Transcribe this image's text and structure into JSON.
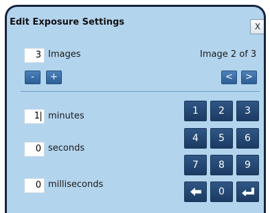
{
  "dialog": {
    "title": "Edit Exposure Settings",
    "close_label": "X"
  },
  "images": {
    "count": "3",
    "label": "Images",
    "minus_label": "-",
    "plus_label": "+",
    "indicator": "Image 2 of 3",
    "prev_label": "<",
    "next_label": ">"
  },
  "exposure": {
    "minutes_value": "1",
    "minutes_label": "minutes",
    "seconds_value": "0",
    "seconds_label": "seconds",
    "milliseconds_value": "0",
    "milliseconds_label": "milliseconds"
  },
  "keypad": {
    "key_1": "1",
    "key_2": "2",
    "key_3": "3",
    "key_4": "4",
    "key_5": "5",
    "key_6": "6",
    "key_7": "7",
    "key_8": "8",
    "key_9": "9",
    "key_0": "0",
    "backspace_icon": "left-arrow-icon",
    "enter_icon": "enter-return-icon"
  },
  "colors": {
    "dialog_bg": "#b3d4ed",
    "border": "#15243c",
    "keypad_key": "#234670",
    "small_button": "#3a6ea6"
  }
}
